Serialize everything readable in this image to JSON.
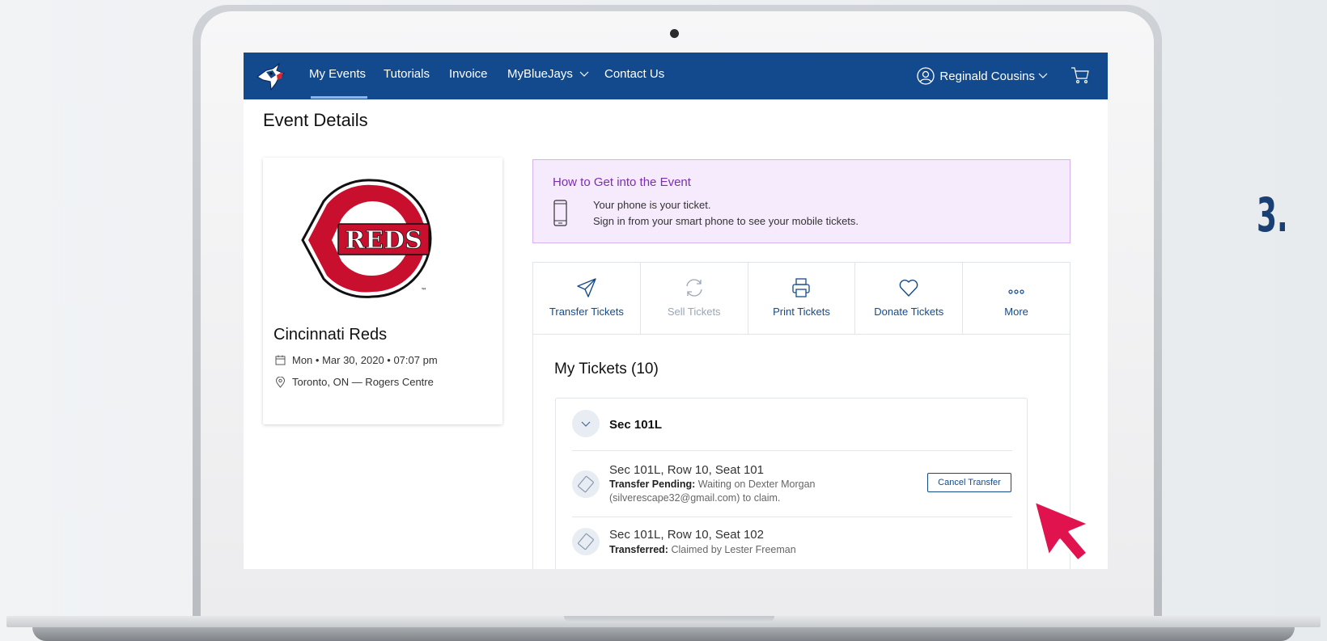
{
  "nav": {
    "links": [
      "My Events",
      "Tutorials",
      "Invoice",
      "MyBlueJays",
      "Contact Us"
    ],
    "user_name": "Reginald Cousins"
  },
  "page_title": "Event Details",
  "event": {
    "team": "Cincinnati Reds",
    "date": "Mon • Mar 30, 2020 • 07:07 pm",
    "location": "Toronto, ON — Rogers Centre",
    "logo_text": "REDS"
  },
  "howto": {
    "title": "How to Get into the Event",
    "line1": "Your phone is your ticket.",
    "line2": "Sign in from your smart phone to see your mobile tickets."
  },
  "actions": [
    {
      "label": "Transfer Tickets",
      "icon": "send-icon",
      "enabled": true
    },
    {
      "label": "Sell Tickets",
      "icon": "refresh-icon",
      "enabled": false
    },
    {
      "label": "Print Tickets",
      "icon": "printer-icon",
      "enabled": true
    },
    {
      "label": "Donate Tickets",
      "icon": "heart-icon",
      "enabled": true
    },
    {
      "label": "More",
      "icon": "more-icon",
      "enabled": true
    }
  ],
  "tickets": {
    "heading": "My Tickets (10)",
    "section": "Sec 101L",
    "items": [
      {
        "title": "Sec 101L, Row 10, Seat 101",
        "status_label": "Transfer Pending:",
        "status_text": "Waiting on Dexter Morgan",
        "status_text2": "(silverescape32@gmail.com) to claim.",
        "action": "Cancel Transfer"
      },
      {
        "title": "Sec 101L, Row 10, Seat 102",
        "status_label": "Transferred:",
        "status_text": "Claimed by Lester Freeman"
      }
    ]
  },
  "step_label": "3.",
  "colors": {
    "nav": "#134a8e",
    "howto_bg": "#f6ebfc",
    "howto_title": "#7a2fb3",
    "cursor": "#e0134f"
  }
}
